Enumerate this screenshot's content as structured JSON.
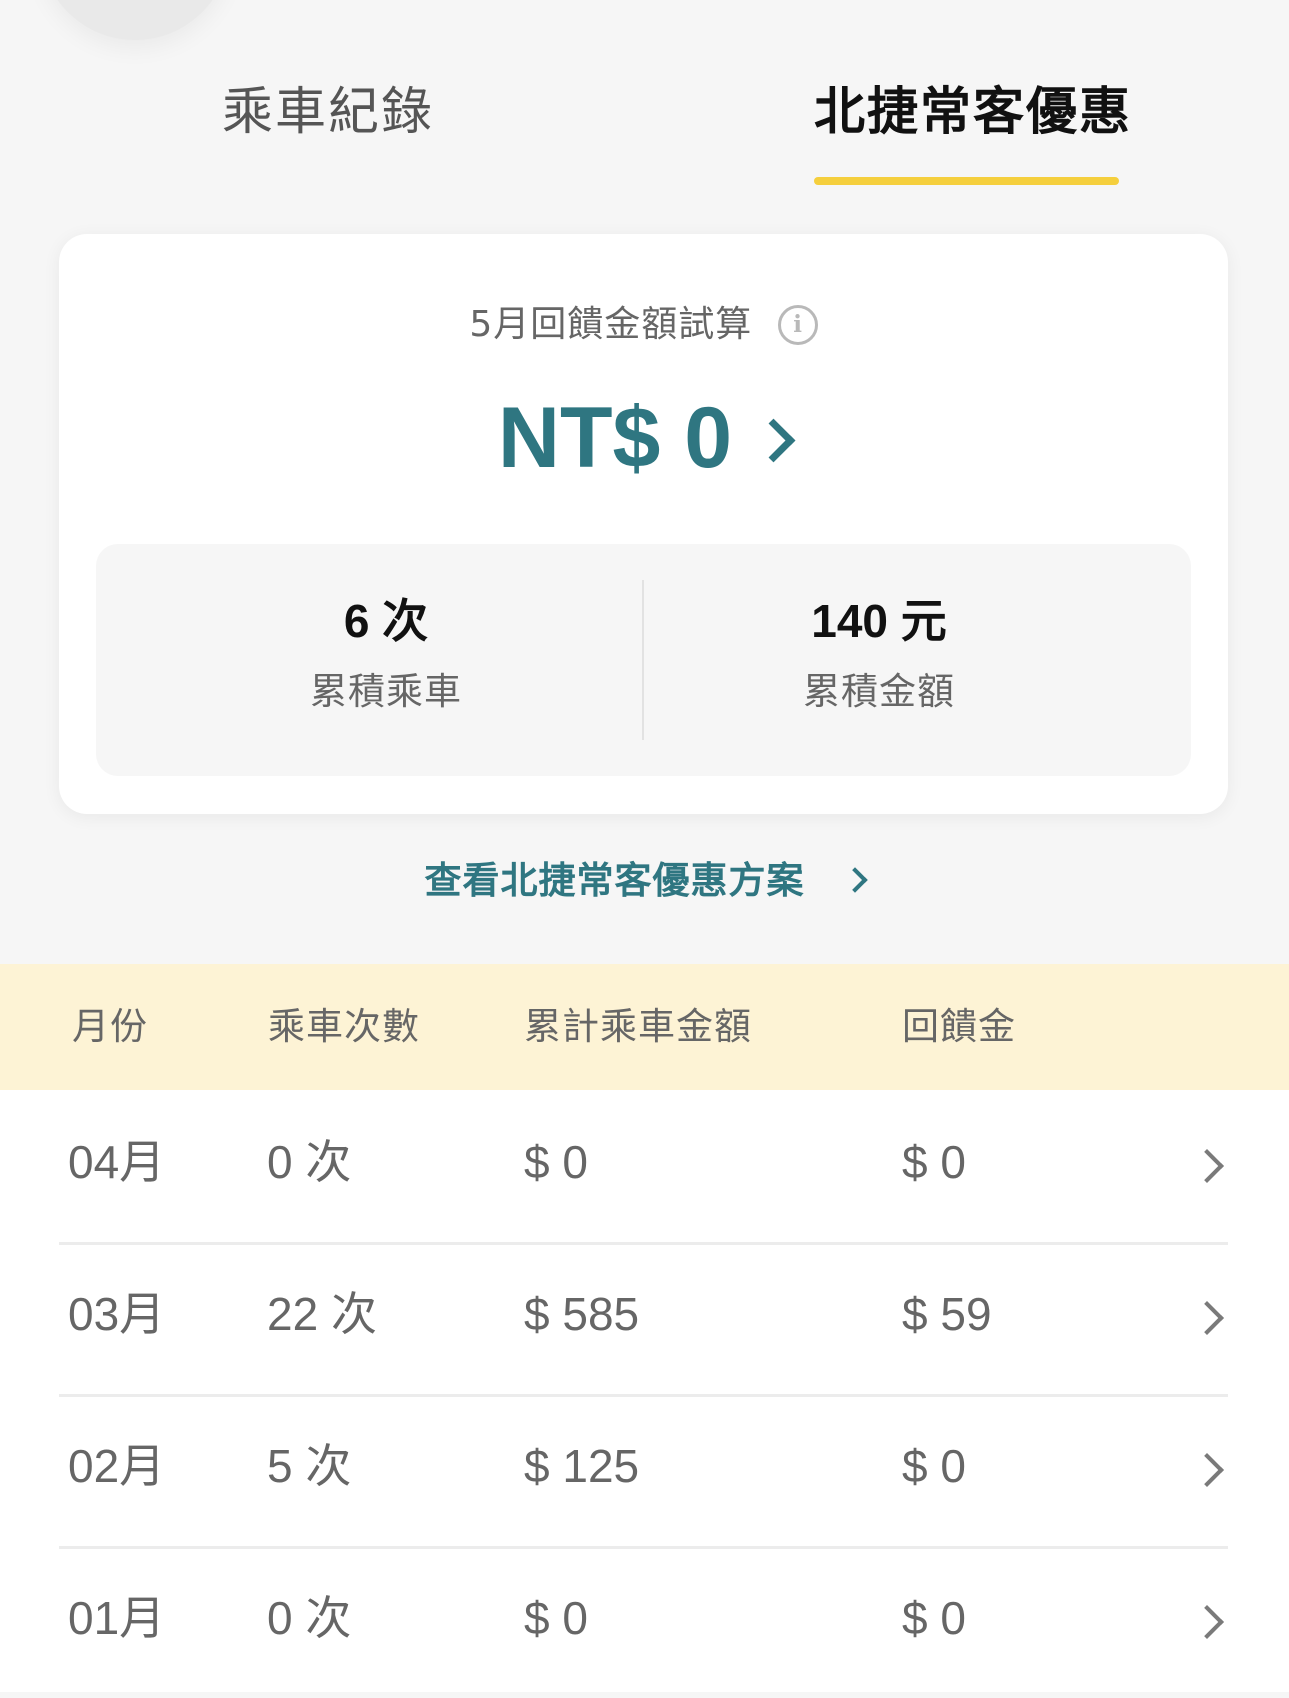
{
  "tabs": {
    "ride_records": "乘車紀錄",
    "frequent_rider_discount": "北捷常客優惠"
  },
  "summary": {
    "estimate_label": "5月回饋金額試算",
    "estimate_amount": "NT$ 0",
    "accumulated_rides_value": "6 次",
    "accumulated_rides_label": "累積乘車",
    "accumulated_amount_value": "140 元",
    "accumulated_amount_label": "累積金額"
  },
  "plan_link": {
    "label": "查看北捷常客優惠方案"
  },
  "table": {
    "headers": {
      "month": "月份",
      "rides": "乘車次數",
      "total_amount": "累計乘車金額",
      "rebate": "回饋金"
    },
    "rows": [
      {
        "month": "04月",
        "rides": "0 次",
        "total": "$ 0",
        "rebate": "$ 0"
      },
      {
        "month": "03月",
        "rides": "22 次",
        "total": "$ 585",
        "rebate": "$ 59"
      },
      {
        "month": "02月",
        "rides": "5 次",
        "total": "$ 125",
        "rebate": "$ 0"
      },
      {
        "month": "01月",
        "rides": "0 次",
        "total": "$ 0",
        "rebate": "$ 0"
      }
    ]
  },
  "icons": {
    "info": "info-icon",
    "chevron": "chevron-right-icon"
  },
  "colors": {
    "accent_teal": "#2f7681",
    "tab_indicator": "#f5cf3d",
    "table_header_bg": "#fdf3d5",
    "page_bg": "#f6f6f6",
    "card_bg": "#ffffff"
  }
}
